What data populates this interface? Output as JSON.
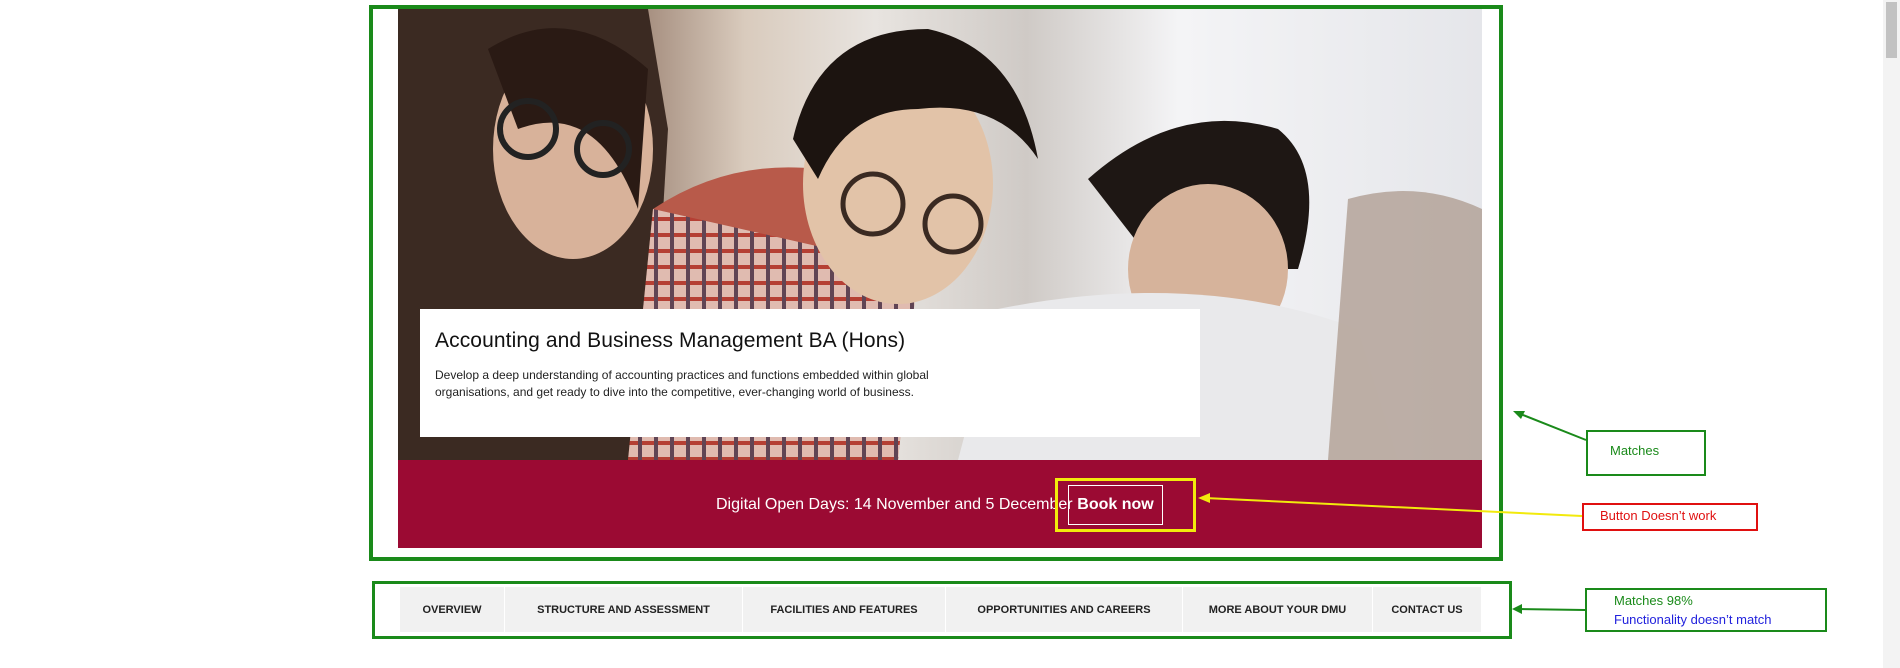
{
  "hero": {
    "title": "Accounting and Business Management BA (Hons)",
    "description": "Develop a deep understanding of accounting practices and functions embedded within global organisations, and get ready to dive into the competitive, ever-changing world of business."
  },
  "banner": {
    "text": "Digital Open Days: 14 November and 5 December",
    "button_label": "Book now"
  },
  "tabs": [
    {
      "label": "OVERVIEW"
    },
    {
      "label": "STRUCTURE AND ASSESSMENT"
    },
    {
      "label": "FACILITIES AND FEATURES"
    },
    {
      "label": "OPPORTUNITIES AND CAREERS"
    },
    {
      "label": "MORE ABOUT YOUR DMU"
    },
    {
      "label": "CONTACT US"
    }
  ],
  "annotations": {
    "matches": "Matches",
    "button_doesnt_work": "Button Doesn’t work",
    "matches_98": "Matches 98%",
    "functionality": "Functionality doesn’t match"
  },
  "colors": {
    "banner": "#9b0a33",
    "annotation_green": "#1a8a1a",
    "annotation_red": "#e01010",
    "annotation_yellow": "#f2ea0c",
    "annotation_blue": "#2222dd"
  }
}
